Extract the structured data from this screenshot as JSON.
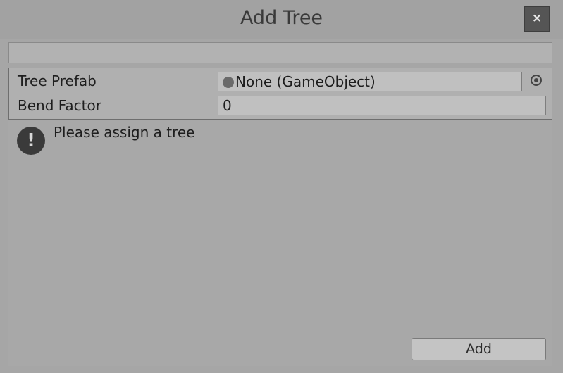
{
  "window": {
    "title": "Add Tree",
    "close_label": "×"
  },
  "properties": {
    "tree_prefab": {
      "label": "Tree Prefab",
      "value": "None (GameObject)",
      "icon": "gameobject-icon"
    },
    "bend_factor": {
      "label": "Bend Factor",
      "value": "0"
    }
  },
  "help": {
    "icon": "warning-icon",
    "icon_glyph": "!",
    "message": "Please assign a tree"
  },
  "footer": {
    "add_label": "Add"
  }
}
